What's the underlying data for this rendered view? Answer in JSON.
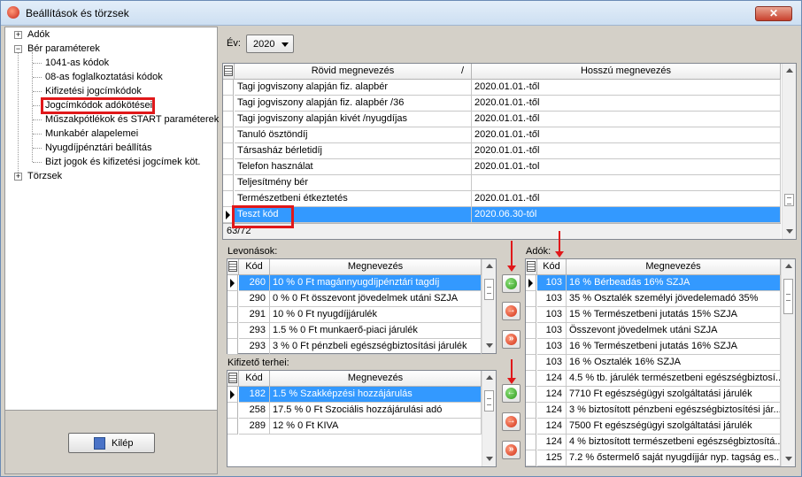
{
  "window": {
    "title": "Beállítások és törzsek",
    "close_label": "✕"
  },
  "tree": {
    "items": [
      {
        "label": "Adók",
        "expander": "+"
      },
      {
        "label": "Bér paraméterek",
        "expander": "−"
      },
      {
        "label": "1041-as kódok"
      },
      {
        "label": "08-as foglalkoztatási kódok"
      },
      {
        "label": "Kifizetési jogcímkódok"
      },
      {
        "label": "Jogcímkódok adókötései"
      },
      {
        "label": "Műszakpótlékok és START paraméterek"
      },
      {
        "label": "Munkabér alapelemei"
      },
      {
        "label": "Nyugdíjpénztári beállítás"
      },
      {
        "label": "Bizt jogok és kifizetési jogcímek köt."
      },
      {
        "label": "Törzsek",
        "expander": "+"
      }
    ],
    "selected_index": 5
  },
  "exit_button": {
    "label": "Kilép"
  },
  "year": {
    "label": "Év:",
    "value": "2020"
  },
  "main_grid": {
    "columns": [
      "Rövid megnevezés",
      "Hosszú megnevezés"
    ],
    "sort_indicator": "/",
    "rows": [
      [
        "Tagi jogviszony alapján fiz. alapbér",
        "2020.01.01.-től"
      ],
      [
        "Tagi jogviszony alapján fiz. alapbér /36",
        "2020.01.01.-től"
      ],
      [
        "Tagi jogviszony alapján kivét /nyugdíjas",
        "2020.01.01.-től"
      ],
      [
        "Tanuló ösztöndíj",
        "2020.01.01.-től"
      ],
      [
        "Társasház bérletidíj",
        "2020.01.01.-től"
      ],
      [
        "Telefon használat",
        "2020.01.01.-tol"
      ],
      [
        "Teljesítmény bér",
        ""
      ],
      [
        "Természetbeni étkeztetés",
        "2020.01.01.-től"
      ],
      [
        "Teszt kód",
        "2020.06.30-tól"
      ]
    ],
    "selected_row": 8,
    "footer": "63/72"
  },
  "levonasok": {
    "label": "Levonások:",
    "columns": [
      "Kód",
      "Megnevezés"
    ],
    "rows": [
      [
        "260",
        "10 % 0 Ft magánnyugdíjpénztári tagdíj"
      ],
      [
        "290",
        "0 % 0 Ft összevont jövedelmek utáni SZJA"
      ],
      [
        "291",
        "10 % 0 Ft nyugdíjjárulék"
      ],
      [
        "293",
        "1.5 % 0 Ft munkaerő-piaci járulék"
      ],
      [
        "293",
        "3 % 0 Ft pénzbeli egészségbiztosítási járulék"
      ]
    ],
    "selected_row": 0
  },
  "kifizeto": {
    "label": "Kifizető terhei:",
    "columns": [
      "Kód",
      "Megnevezés"
    ],
    "rows": [
      [
        "182",
        "1.5 % Szakképzési hozzájárulás"
      ],
      [
        "258",
        "17.5 % 0 Ft Szociális hozzájárulási adó"
      ],
      [
        "289",
        "12 % 0 Ft KIVA"
      ]
    ],
    "selected_row": 0
  },
  "adok": {
    "label": "Adók:",
    "columns": [
      "Kód",
      "Megnevezés"
    ],
    "rows": [
      [
        "103",
        "16 %  Bérbeadás 16% SZJA"
      ],
      [
        "103",
        "35 %  Osztalék személyi jövedelemadó 35%"
      ],
      [
        "103",
        "15 %  Természetbeni jutatás 15% SZJA"
      ],
      [
        "103",
        "   Összevont jövedelmek utáni SZJA"
      ],
      [
        "103",
        "16 %  Természetbeni jutatás 16% SZJA"
      ],
      [
        "103",
        "16 %  Osztalék 16% SZJA"
      ],
      [
        "124",
        "4.5 %  tb. járulék természetbeni egészségbiztosí..."
      ],
      [
        "124",
        "7710 Ft egészségügyi szolgáltatási járulék"
      ],
      [
        "124",
        "3 %  biztosított pénzbeni egészségbiztosítési jár..."
      ],
      [
        "124",
        "7500 Ft egészségügyi szolgáltatási járulék"
      ],
      [
        "124",
        "4 %  biztosított természetbeni egészségbiztosítá..."
      ],
      [
        "125",
        "7.2 %  őstermelő saját nyugdíjjár nyp. tagság es..."
      ]
    ],
    "selected_row": 0
  },
  "buttons": {
    "add": "←",
    "remove": "→",
    "remove_all": "»"
  },
  "colors": {
    "selection": "#3399ff",
    "highlight": "#e0181a"
  }
}
